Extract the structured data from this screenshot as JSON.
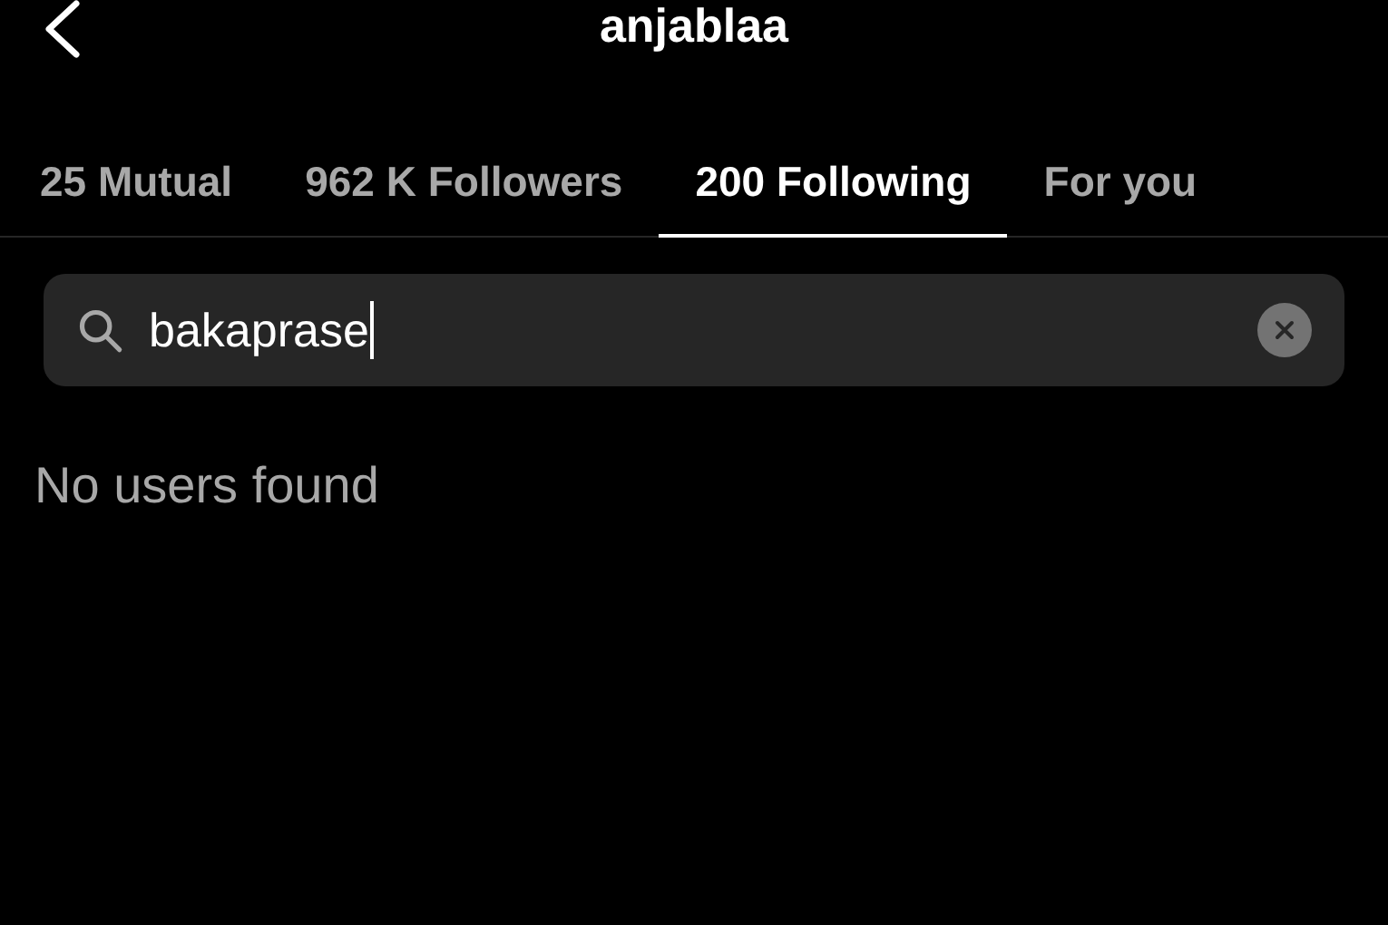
{
  "header": {
    "title": "anjablaa"
  },
  "tabs": [
    {
      "label": "25 Mutual",
      "selected": false
    },
    {
      "label": "962 K Followers",
      "selected": false
    },
    {
      "label": "200 Following",
      "selected": true
    },
    {
      "label": "For you",
      "selected": false
    }
  ],
  "search": {
    "value": "bakaprase"
  },
  "message": "No users found"
}
